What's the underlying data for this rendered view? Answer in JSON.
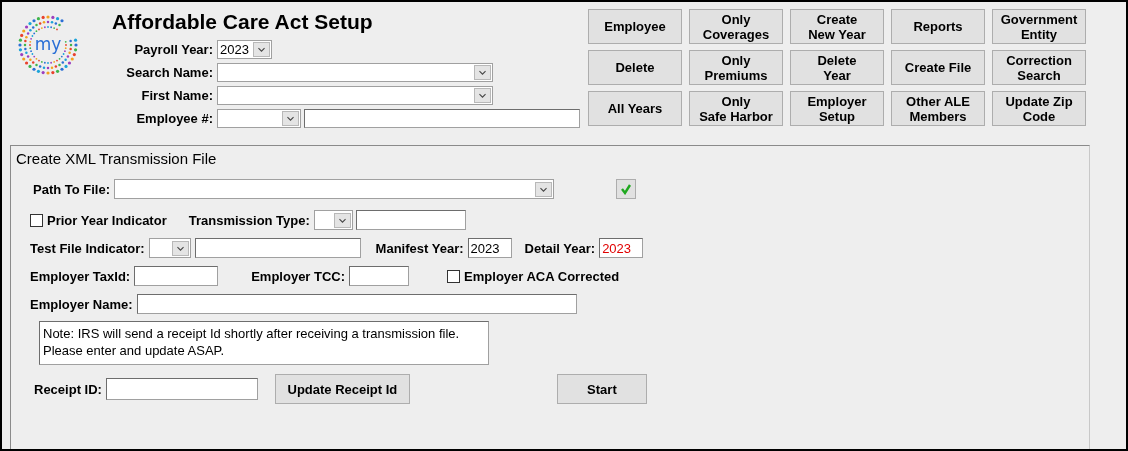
{
  "logo": {
    "text": "my"
  },
  "header": {
    "title": "Affordable Care Act Setup",
    "payroll_year": {
      "label": "Payroll Year:",
      "value": "2023"
    },
    "search_name": {
      "label": "Search Name:"
    },
    "first_name": {
      "label": "First Name:"
    },
    "employee_no": {
      "label": "Employee #:"
    }
  },
  "buttons": [
    "Employee",
    "Only\nCoverages",
    "Create\nNew Year",
    "Reports",
    "Government\nEntity",
    "Delete",
    "Only\nPremiums",
    "Delete\nYear",
    "Create File",
    "Correction\nSearch",
    "All Years",
    "Only\nSafe Harbor",
    "Employer\nSetup",
    "Other ALE\nMembers",
    "Update Zip\nCode"
  ],
  "panel": {
    "title": "Create XML Transmission File",
    "path_to_file": {
      "label": "Path To File:"
    },
    "prior_year": {
      "label": "Prior Year Indicator",
      "checked": false
    },
    "transmission_type": {
      "label": "Transmission Type:"
    },
    "test_file_indicator": {
      "label": "Test File Indicator:"
    },
    "manifest_year": {
      "label": "Manifest Year:",
      "value": "2023",
      "error": false
    },
    "detail_year": {
      "label": "Detail Year:",
      "value": "2023",
      "error": true
    },
    "employer_taxid": {
      "label": "Employer TaxId:"
    },
    "employer_tcc": {
      "label": "Employer TCC:"
    },
    "aca_corrected": {
      "label": "Employer ACA Corrected",
      "checked": false
    },
    "employer_name": {
      "label": "Employer Name:"
    },
    "note": "Note:  IRS will send a receipt Id shortly after receiving a transmission file. Please enter and update ASAP.",
    "receipt_id": {
      "label": "Receipt ID:"
    },
    "update_button": "Update Receipt Id",
    "start_button": "Start"
  }
}
